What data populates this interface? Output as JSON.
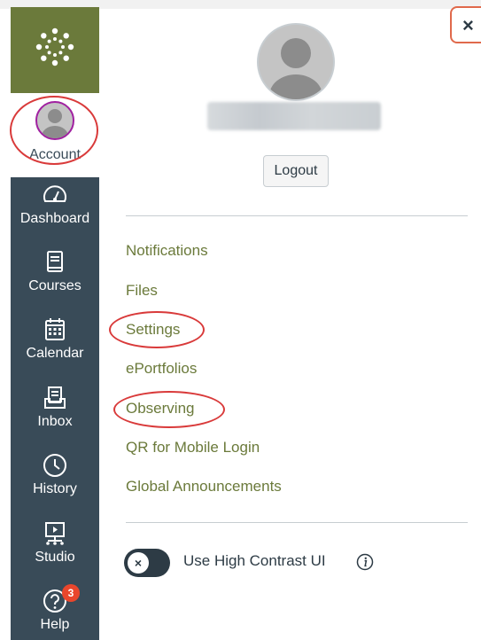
{
  "nav": {
    "logo_icon": "canvas-logo-icon",
    "account": {
      "label": "Account",
      "icon": "user-avatar-icon"
    },
    "items": [
      {
        "label": "Dashboard",
        "icon": "dashboard-gauge-icon"
      },
      {
        "label": "Courses",
        "icon": "book-icon"
      },
      {
        "label": "Calendar",
        "icon": "calendar-icon"
      },
      {
        "label": "Inbox",
        "icon": "inbox-icon"
      },
      {
        "label": "History",
        "icon": "clock-icon"
      },
      {
        "label": "Studio",
        "icon": "studio-play-icon"
      },
      {
        "label": "Help",
        "icon": "question-icon",
        "badge": "3"
      }
    ]
  },
  "tray": {
    "close_icon": "close-icon",
    "close_glyph": "×",
    "logout_label": "Logout",
    "links": [
      "Notifications",
      "Files",
      "Settings",
      "ePortfolios",
      "Observing",
      "QR for Mobile Login",
      "Global Announcements"
    ],
    "toggle": {
      "label": "Use High Contrast UI",
      "knob_glyph": "×",
      "state": "off",
      "info_icon": "info-icon"
    }
  },
  "colors": {
    "nav_bg": "#394b58",
    "brand": "#6b7a3b",
    "link": "#6b7a3b",
    "annotation": "#d93a3a",
    "badge": "#e9462c"
  }
}
